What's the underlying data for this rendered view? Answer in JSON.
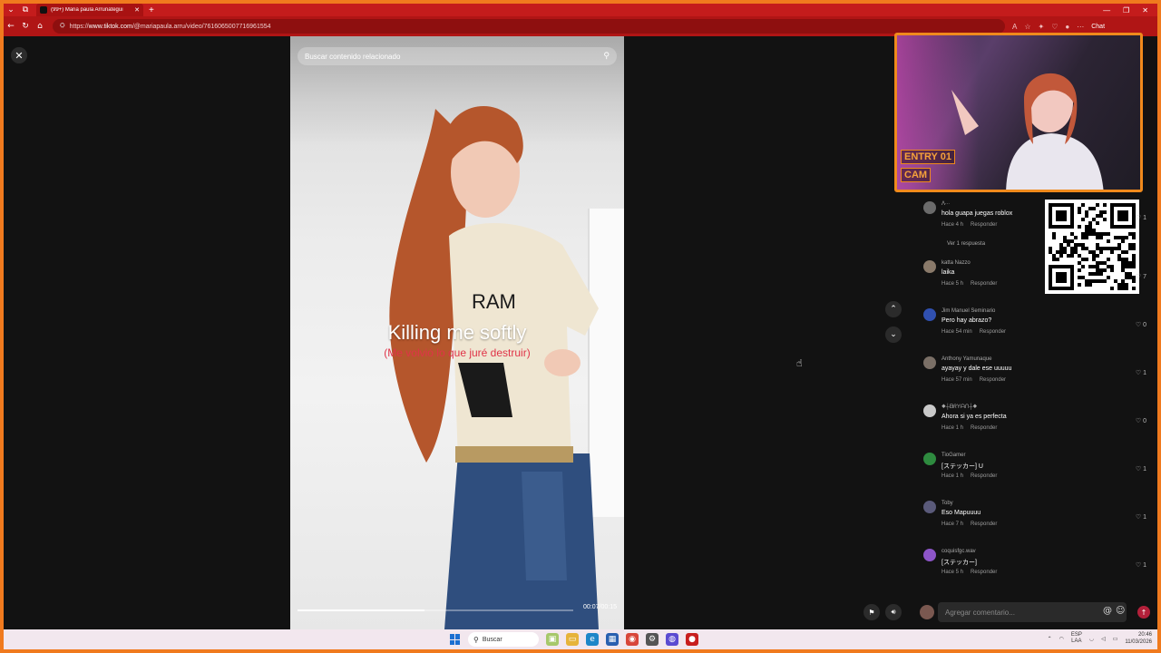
{
  "browser": {
    "tab_title": "(99+) Maria paula Arrunategui",
    "url_prefix": "https://",
    "url_host": "www.tiktok.com",
    "url_path": "/@mariapaula.arru/video/7616065007716961554",
    "chat_label": "Chat"
  },
  "video": {
    "search_placeholder": "Buscar contenido relacionado",
    "caption_main": "Killing me softly",
    "caption_sub": "(Me volvió lo que juré destruir)",
    "timecode": "00:07/00:15",
    "progress_fraction": 0.46
  },
  "webcam": {
    "badge1": "ENTRY 01",
    "badge2": "CAM"
  },
  "comments": [
    {
      "user": "Ʌ∙∙∙",
      "text": "hola guapa juegas roblox",
      "time": "Hace 4 h",
      "reply": "Responder",
      "likes": "1",
      "avatar_color": "#6b6b6b"
    },
    {
      "user": "katta Nazzo",
      "text": "laika",
      "time": "Hace 5 h",
      "reply": "Responder",
      "likes": "7",
      "avatar_color": "#8a7a6a"
    },
    {
      "user": "Jim Manuel Seminario",
      "text": "Pero hay abrazo?",
      "time": "Hace 54 min",
      "reply": "Responder",
      "likes": "0",
      "avatar_color": "#3050b0"
    },
    {
      "user": "Anthony Yamunaque",
      "text": "ayayay y dale ese uuuuu",
      "time": "Hace 57 min",
      "reply": "Responder",
      "likes": "1",
      "avatar_color": "#7a6f66"
    },
    {
      "user": "◆┼ᗷᖇYᗩᑎ┼◆",
      "text": "Ahora si ya es perfecta",
      "time": "Hace 1 h",
      "reply": "Responder",
      "likes": "0",
      "avatar_color": "#c9c9c9"
    },
    {
      "user": "TioGamer",
      "text": "[ステッカー] U",
      "time": "Hace 1 h",
      "reply": "Responder",
      "likes": "1",
      "avatar_color": "#2e8b3f"
    },
    {
      "user": "Toby",
      "text": "Eso Mapuuuu",
      "time": "Hace 7 h",
      "reply": "Responder",
      "likes": "1",
      "avatar_color": "#5a5a7a"
    },
    {
      "user": "coquisfgc.wav",
      "text": "[ステッカー]",
      "time": "Hace 5 h",
      "reply": "Responder",
      "likes": "1",
      "avatar_color": "#8d55c8"
    }
  ],
  "view_replies": "Ver 1 respuesta",
  "comment_input_placeholder": "Agregar comentario...",
  "taskbar": {
    "search_label": "Buscar",
    "lang_top": "ESP",
    "lang_bottom": "LAA",
    "time": "20:46",
    "date": "11/03/2026"
  }
}
